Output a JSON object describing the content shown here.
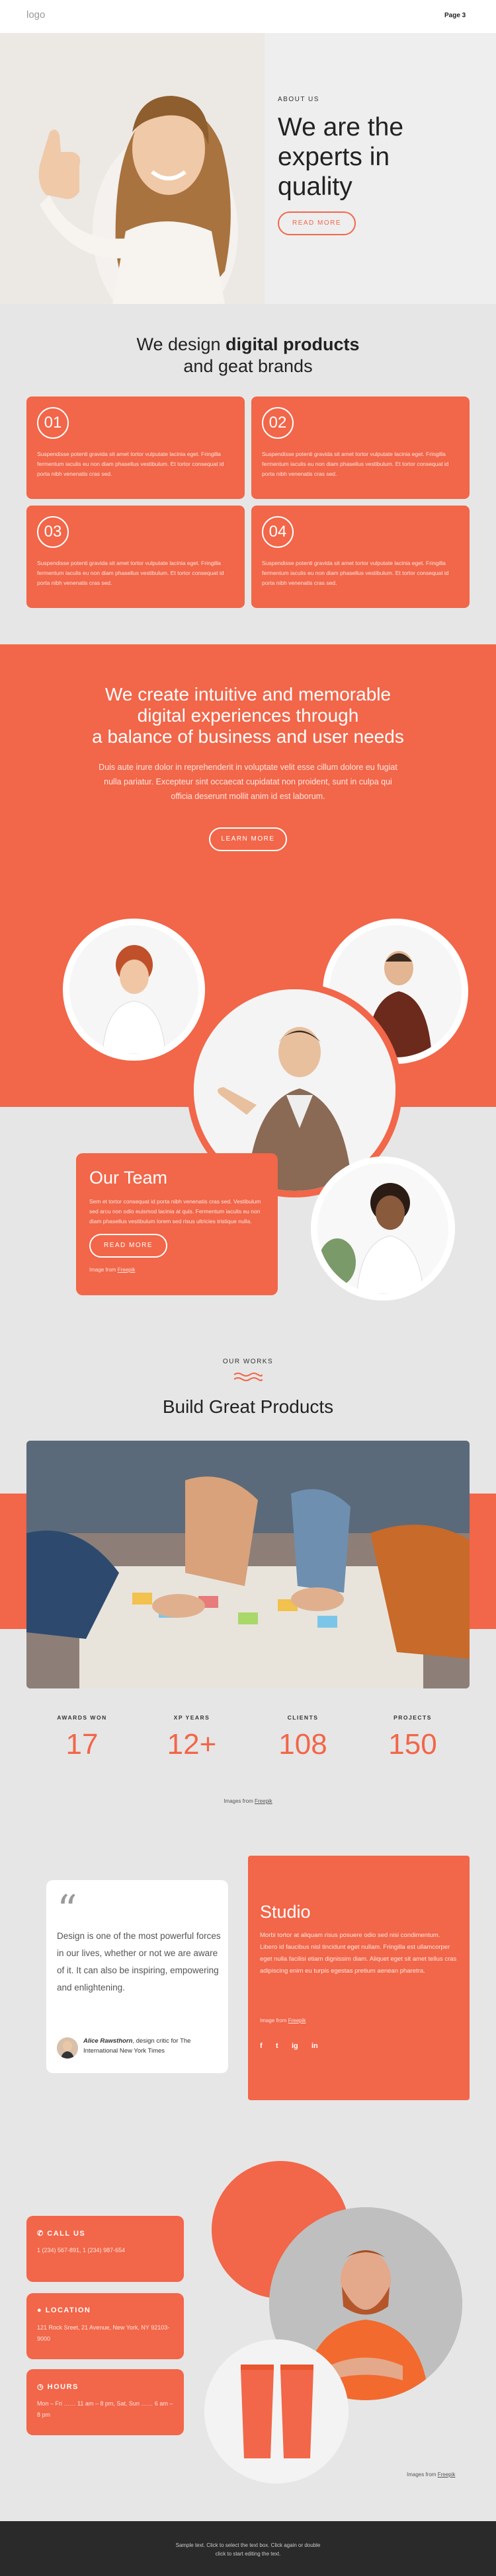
{
  "header": {
    "logo": "logo",
    "nav_item": "Page 3"
  },
  "hero": {
    "eyebrow": "ABOUT US",
    "title_line1": "We are the",
    "title_line2": "experts in",
    "title_line3": "quality",
    "button": "READ MORE"
  },
  "design": {
    "title_pre": "We design ",
    "title_bold": "digital products",
    "title_line2": "and geat brands",
    "cards": [
      {
        "num": "01",
        "text": "Suspendisse potenti gravida sit amet tortor vulputate lacinia eget. Fringilla fermentum iaculis eu non diam phasellus vestibulum. Et tortor consequat id porta nibh venenatis cras sed."
      },
      {
        "num": "02",
        "text": "Suspendisse potenti gravida sit amet tortor vulputate lacinia eget. Fringilla fermentum iaculis eu non diam phasellus vestibulum. Et tortor consequat id porta nibh venenatis cras sed."
      },
      {
        "num": "03",
        "text": "Suspendisse potenti gravida sit amet tortor vulputate lacinia eget. Fringilla fermentum iaculis eu non diam phasellus vestibulum. Et tortor consequat id porta nibh venenatis cras sed."
      },
      {
        "num": "04",
        "text": "Suspendisse potenti gravida sit amet tortor vulputate lacinia eget. Fringilla fermentum iaculis eu non diam phasellus vestibulum. Et tortor consequat id porta nibh venenatis cras sed."
      }
    ]
  },
  "create": {
    "title_line1": "We create intuitive and memorable",
    "title_line2": "digital experiences through",
    "title_line3": "a balance of business and user needs",
    "text": "Duis aute irure dolor in reprehenderit in voluptate velit esse cillum dolore eu fugiat nulla pariatur. Excepteur sint occaecat cupidatat non proident, sunt in culpa qui officia deserunt mollit anim id est laborum.",
    "button": "LEARN MORE"
  },
  "team": {
    "title": "Our Team",
    "text": "Sem et tortor consequat id porta nibh venenatis cras sed. Vestibulum sed arcu non odio euismod lacinia at quis. Fermentum iaculis eu non diam phasellus vestibulum lorem sed risus ultricies tristique nulla.",
    "button": "READ MORE",
    "credit_pre": "Image from ",
    "credit_link": "Freepik"
  },
  "works": {
    "eyebrow": "OUR WORKS",
    "title": "Build Great Products",
    "stats": [
      {
        "label": "AWARDS WON",
        "value": "17"
      },
      {
        "label": "XP YEARS",
        "value": "12+"
      },
      {
        "label": "CLIENTS",
        "value": "108"
      },
      {
        "label": "PROJECTS",
        "value": "150"
      }
    ],
    "credit_pre": "Images from ",
    "credit_link": "Freepik"
  },
  "quote": {
    "mark": "“",
    "text": "Design is one of the most powerful forces in our lives, whether or not we are aware of it. It can also be inspiring, empowering and enlightening.",
    "author_name": "Alice Rawsthorn",
    "author_role": ", design critic for The International New York Times"
  },
  "studio": {
    "title": "Studio",
    "text": "Morbi tortor at aliquam risus posuere odio sed nisi condimentum. Libero id faucibus nisl tincidunt eget nullam. Fringilla est ullamcorper eget nulla facilisi etiam dignissim diam. Aliquet eget sit amet tellus cras adipiscing enim eu turpis egestas pretium aenean pharetra.",
    "credit_pre": "Image from ",
    "credit_link": "Freepik",
    "socials": [
      "f",
      "t",
      "ig",
      "in"
    ]
  },
  "contact": {
    "call_title": "CALL US",
    "call_text": "1 (234) 567-891, 1 (234) 987-654",
    "location_title": "LOCATION",
    "location_text": "121 Rock Sreet, 21 Avenue, New York, NY 92103-9000",
    "hours_title": "HOURS",
    "hours_text": "Mon – Fri …… 11 am – 8 pm, Sat, Sun …… 6 am – 8 pm",
    "credit_pre": "Images from ",
    "credit_link": "Freepik"
  },
  "footer": {
    "line1": "Sample text. Click to select the text box. Click again or double",
    "line2": "click to start editing the text."
  }
}
